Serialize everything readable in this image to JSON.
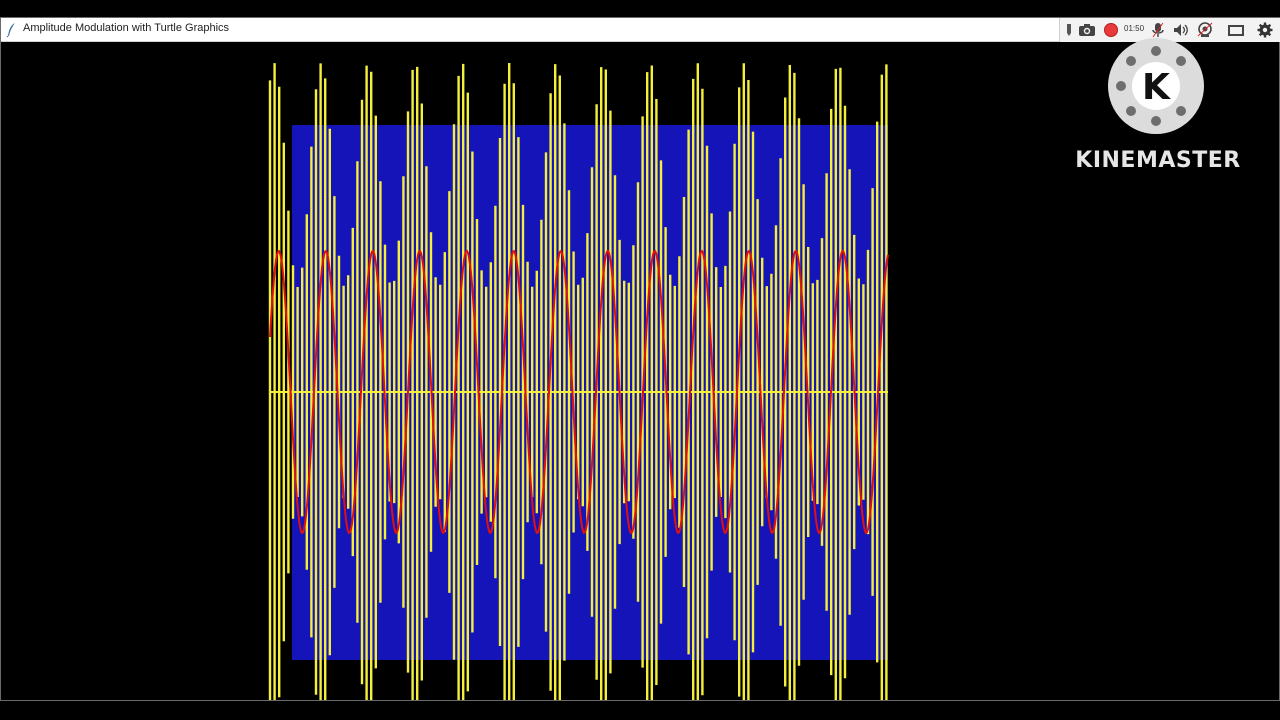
{
  "window": {
    "title": "Amplitude Modulation with Turtle Graphics"
  },
  "recorder_toolbar": {
    "elapsed": "01:50",
    "icons": [
      "pen-icon",
      "camera-icon",
      "record-icon",
      "microphone-icon",
      "speaker-icon",
      "webcam-icon",
      "window-icon",
      "settings-icon"
    ]
  },
  "watermark": {
    "brand": "KINEMASTER",
    "logo_letter": "K"
  },
  "colors": {
    "background": "#000000",
    "carrier_wave": "#f4ef3a",
    "envelope_band": "#1414b8",
    "message_wave": "#e01010"
  }
}
